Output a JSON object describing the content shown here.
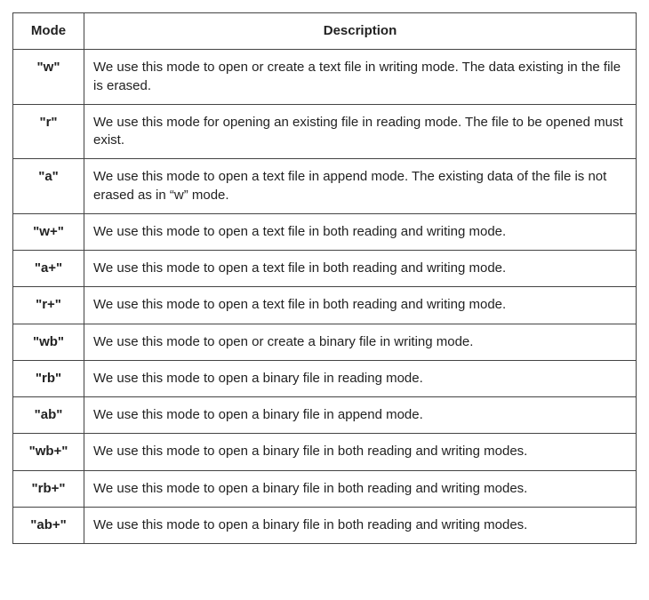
{
  "chart_data": {
    "type": "table",
    "columns": [
      "Mode",
      "Description"
    ],
    "rows": [
      [
        "\"w\"",
        "We use this mode to open or create a text file in writing mode. The data existing in the file is erased."
      ],
      [
        "\"r\"",
        "We use this mode for opening an existing file in reading mode. The file to be opened must exist."
      ],
      [
        "\"a\"",
        "We use this mode to open a text file in append mode. The existing data of the file is not erased as in “w” mode."
      ],
      [
        "\"w+\"",
        "We use this mode to open a text file in both reading and writing mode."
      ],
      [
        "\"a+\"",
        "We use this mode to open a text file in both reading and writing mode."
      ],
      [
        "\"r+\"",
        "We use this mode to open a text file in both reading and writing mode."
      ],
      [
        "\"wb\"",
        "We use this mode to open or create a binary file in writing mode."
      ],
      [
        "\"rb\"",
        "We use this mode to open a binary file in reading mode."
      ],
      [
        "\"ab\"",
        "We use this mode to open a binary file in append mode."
      ],
      [
        "\"wb+\"",
        "We use this mode to open a binary file in both reading and writing modes."
      ],
      [
        "\"rb+\"",
        "We use this mode to open a binary file in both reading and writing modes."
      ],
      [
        "\"ab+\"",
        "We use this mode to open a binary file in both reading and writing modes."
      ]
    ]
  }
}
